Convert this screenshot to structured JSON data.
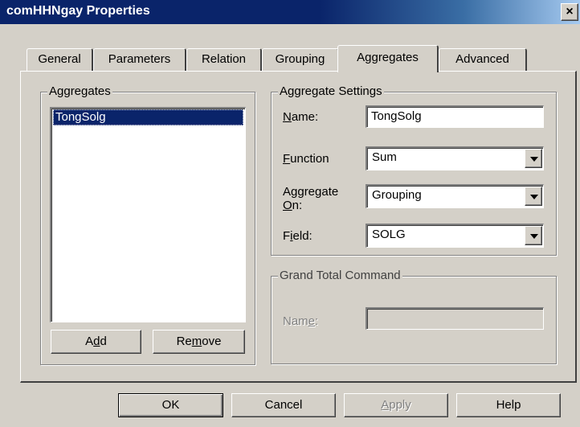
{
  "window": {
    "title": "comHHNgay Properties",
    "close_glyph": "×"
  },
  "tabs": [
    {
      "label": "General",
      "active": false
    },
    {
      "label": "Parameters",
      "active": false
    },
    {
      "label": "Relation",
      "active": false
    },
    {
      "label": "Grouping",
      "active": false
    },
    {
      "label": "Aggregates",
      "active": true
    },
    {
      "label": "Advanced",
      "active": false
    }
  ],
  "aggregates_group": {
    "legend": "Aggregates",
    "items": [
      "TongSolg"
    ],
    "selected_index": 0,
    "add_label_pre": "A",
    "add_label_mn": "d",
    "add_label_post": "d",
    "remove_label_pre": "Re",
    "remove_label_mn": "m",
    "remove_label_post": "ove"
  },
  "settings_group": {
    "legend": "Aggregate Settings",
    "name_label_mn": "N",
    "name_label_post": "ame:",
    "name_value": "TongSolg",
    "function_label_mn": "F",
    "function_label_post": "unction",
    "function_value": "Sum",
    "aggon_label_line1": "Aggregate",
    "aggon_label_mn": "O",
    "aggon_label_post": "n:",
    "aggon_value": "Grouping",
    "field_label_pre": "F",
    "field_label_mn": "i",
    "field_label_post": "eld:",
    "field_value": "SOLG"
  },
  "grand_total_group": {
    "legend": "Grand Total Command",
    "name_label_pre": "Nam",
    "name_label_mn": "e",
    "name_label_post": ":",
    "name_value": ""
  },
  "buttons": {
    "ok": "OK",
    "cancel": "Cancel",
    "apply_mn": "A",
    "apply_post": "pply",
    "help": "Help"
  },
  "colors": {
    "face": "#d4d0c8",
    "title_start": "#0a246a",
    "title_end": "#a6caf0",
    "selection": "#0a246a"
  }
}
